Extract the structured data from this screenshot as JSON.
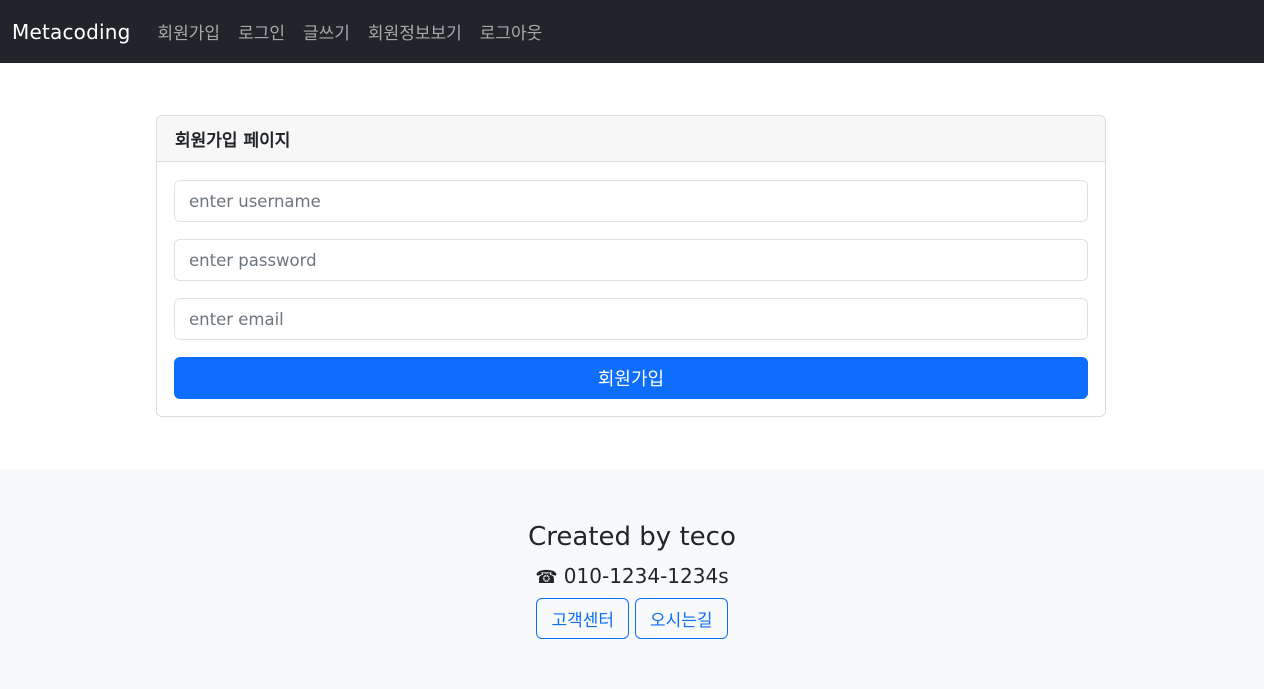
{
  "navbar": {
    "brand": "Metacoding",
    "links": [
      "회원가입",
      "로그인",
      "글쓰기",
      "회원정보보기",
      "로그아웃"
    ]
  },
  "card": {
    "header": "회원가입 페이지",
    "fields": {
      "username_placeholder": "enter username",
      "password_placeholder": "enter password",
      "email_placeholder": "enter email"
    },
    "submit_label": "회원가입"
  },
  "footer": {
    "title": "Created by teco",
    "phone_icon": "☎",
    "phone": "010-1234-1234s",
    "buttons": [
      "고객센터",
      "오시는길"
    ]
  },
  "colors": {
    "navbar_bg": "#212529",
    "primary": "#0d6efd",
    "footer_bg": "#f8f9fa"
  }
}
